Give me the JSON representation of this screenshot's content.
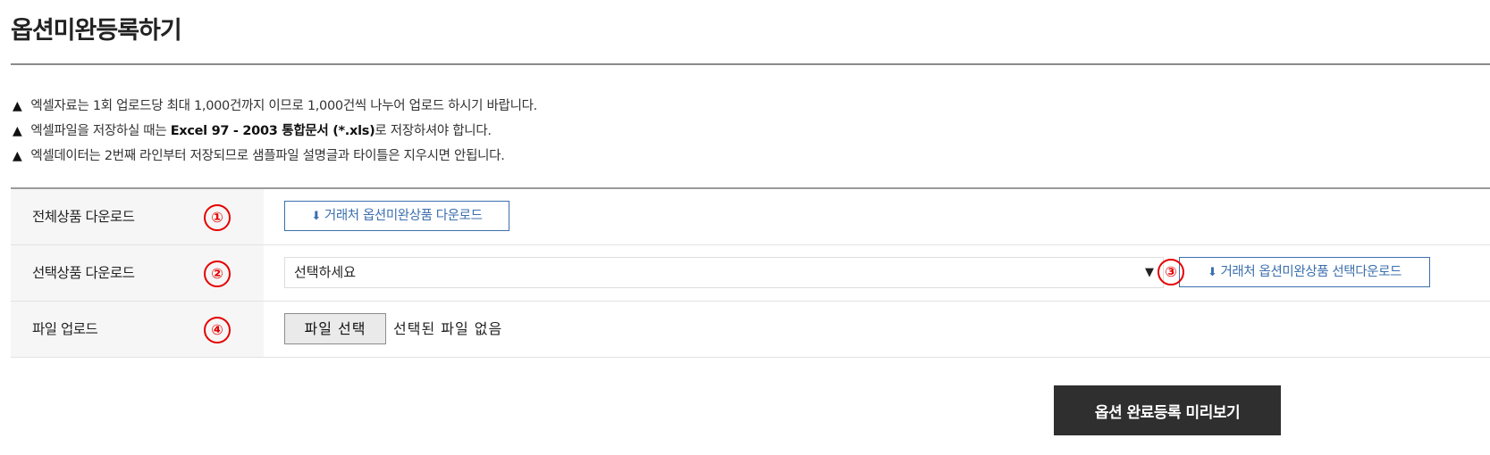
{
  "page": {
    "title": "옵션미완등록하기"
  },
  "notices": [
    {
      "icon": "warning-icon",
      "before": "엑셀자료는 1회 업로드당 최대 1,000건까지 이므로 1,000건씩 나누어 업로드 하시기 바랍니다.",
      "bold": "",
      "after": ""
    },
    {
      "icon": "warning-icon",
      "before": "엑셀파일을 저장하실 때는 ",
      "bold": "Excel 97 - 2003 통합문서 (*.xls)",
      "after": "로 저장하셔야 합니다."
    },
    {
      "icon": "warning-icon",
      "before": "엑셀데이터는 2번째 라인부터 저장되므로 샘플파일 설명글과 타이틀은 지우시면 안됩니다.",
      "bold": "",
      "after": ""
    }
  ],
  "rows": {
    "all_download": {
      "label": "전체상품 다운로드",
      "step": "①",
      "button_label": "거래처 옵션미완상품 다운로드"
    },
    "selected_download": {
      "label": "선택상품 다운로드",
      "step": "②",
      "select_value": "선택하세요",
      "step_button": "③",
      "button_label": "거래처 옵션미완상품 선택다운로드"
    },
    "file_upload": {
      "label": "파일 업로드",
      "step": "④",
      "file_button_label": "파일 선택",
      "file_status": "선택된 파일 없음"
    }
  },
  "actions": {
    "preview_label": "옵션 완료등록 미리보기"
  },
  "icons": {
    "warning": "warning-icon",
    "download": "download-icon",
    "dropdown": "chevron-down-icon"
  },
  "colors": {
    "accent": "#3c6fae",
    "step_marker": "#e60000",
    "primary_button": "#2f2f2f"
  }
}
